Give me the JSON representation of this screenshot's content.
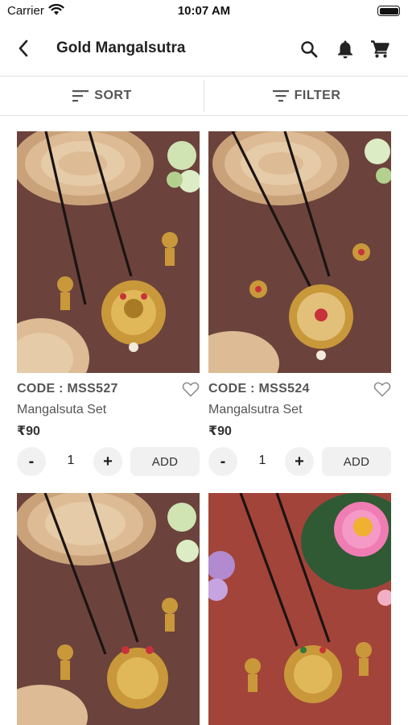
{
  "status_bar": {
    "carrier": "Carrier",
    "time": "10:07 AM"
  },
  "header": {
    "title": "Gold Mangalsutra",
    "icons": [
      "back-arrow-icon",
      "search-icon",
      "bell-icon",
      "cart-icon"
    ]
  },
  "toolbar": {
    "sort_label": "SORT",
    "filter_label": "FILTER"
  },
  "colors": {
    "brown_background": "#6b433c",
    "red_background": "#a3443a",
    "gold": "#c9983a",
    "wood": "#d8b48d",
    "button_gray": "#f1f1f1"
  },
  "products": [
    {
      "code": "CODE : MSS527",
      "name": "Mangalsuta Set",
      "price": "₹90",
      "qty": "1",
      "add_label": "ADD",
      "minus_label": "-",
      "plus_label": "+"
    },
    {
      "code": "CODE : MSS524",
      "name": "Mangalsutra Set",
      "price": "₹90",
      "qty": "1",
      "add_label": "ADD",
      "minus_label": "-",
      "plus_label": "+"
    },
    {
      "code": "",
      "name": "",
      "price": "",
      "qty": "",
      "add_label": "",
      "minus_label": "",
      "plus_label": ""
    },
    {
      "code": "",
      "name": "",
      "price": "",
      "qty": "",
      "add_label": "",
      "minus_label": "",
      "plus_label": ""
    }
  ]
}
